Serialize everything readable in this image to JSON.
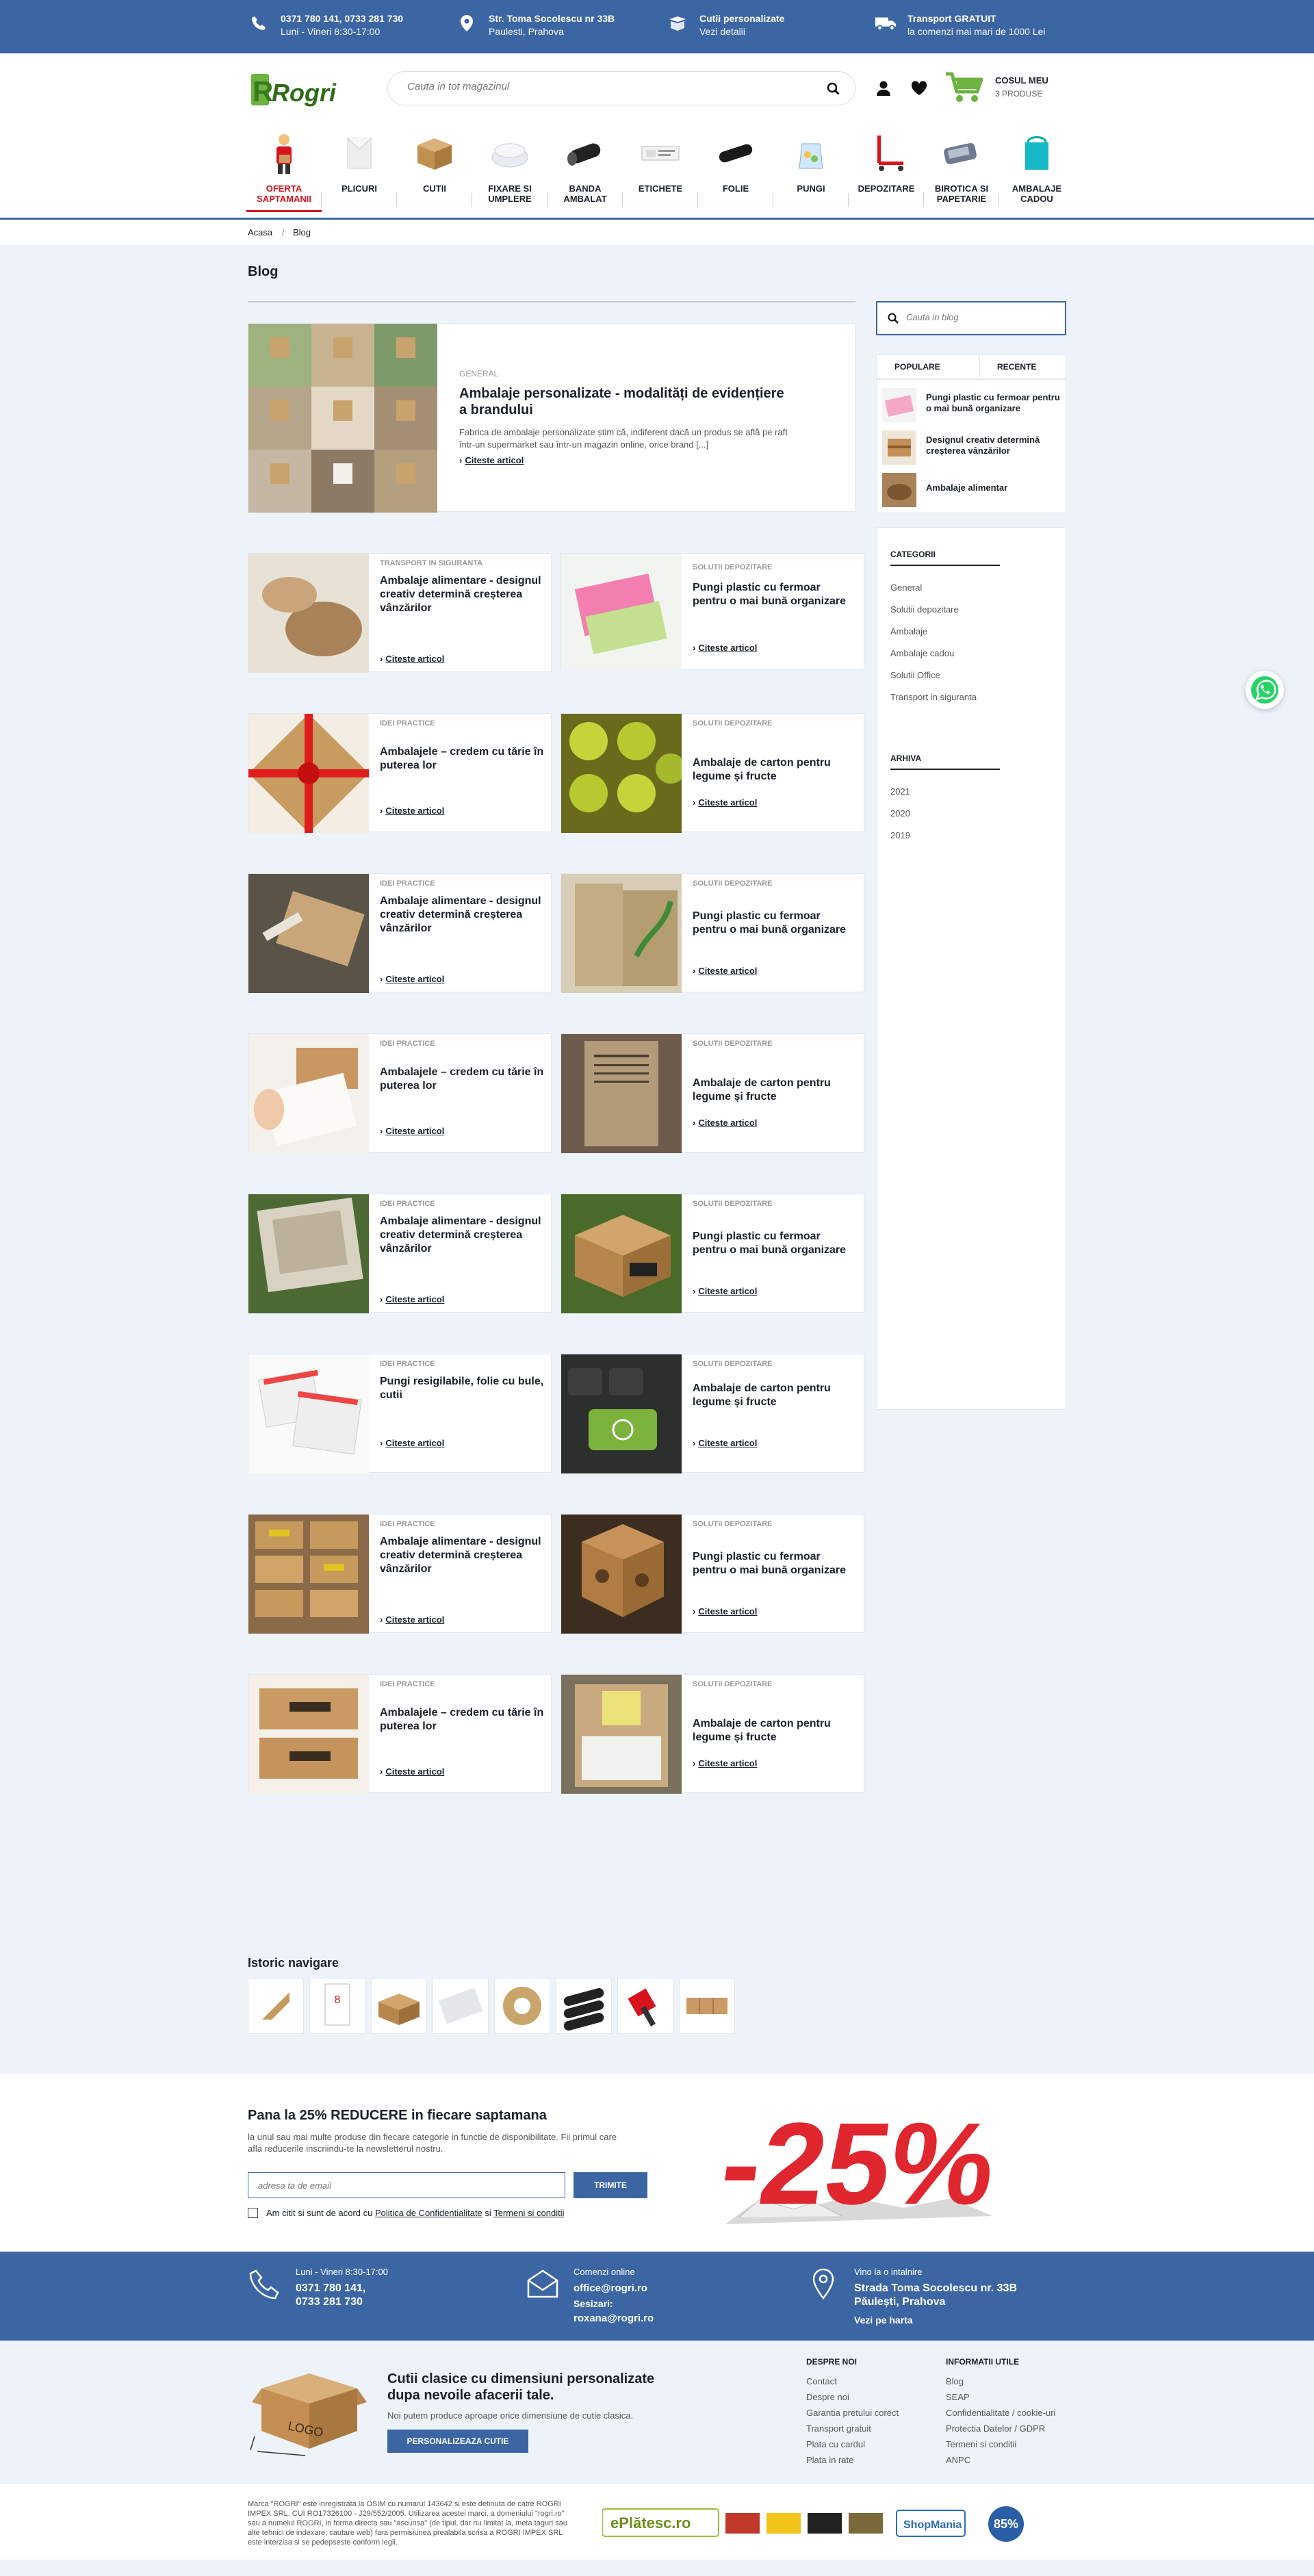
{
  "topbar": {
    "phone": {
      "line1": "0371 780 141, 0733 281 730",
      "line2": "Luni - Vineri 8:30-17:00"
    },
    "address": {
      "line1": "Str. Toma Socolescu nr 33B",
      "line2": "Paulesti, Prahova"
    },
    "custom": {
      "line1": "Cutii personalizate",
      "line2": "Vezi detalii"
    },
    "transport": {
      "line1": "Transport GRATUIT",
      "line2": "la comenzi mai mari de 1000 Lei"
    }
  },
  "logo": "Rogri",
  "search": {
    "placeholder": "Cauta in tot magazinul"
  },
  "cart": {
    "title": "COSUL MEU",
    "count": "3 PRODUSE"
  },
  "categories": [
    {
      "label": "OFERTA SAPTAMANII",
      "active": true
    },
    {
      "label": "PLICURI"
    },
    {
      "label": "CUTII"
    },
    {
      "label": "FIXARE SI UMPLERE"
    },
    {
      "label": "BANDA AMBALAT"
    },
    {
      "label": "ETICHETE"
    },
    {
      "label": "FOLIE"
    },
    {
      "label": "PUNGI"
    },
    {
      "label": "DEPOZITARE"
    },
    {
      "label": "BIROTICA SI PAPETARIE"
    },
    {
      "label": "AMBALAJE CADOU"
    }
  ],
  "breadcrumb": {
    "home": "Acasa",
    "sep": "/",
    "current": "Blog"
  },
  "page": {
    "title": "Blog"
  },
  "featured": {
    "tag": "GENERAL",
    "title": "Ambalaje personalizate - modalități de evidențiere a brandului",
    "excerpt": "Fabrica de ambalaje personalizate știm că, indiferent dacă un produs se află pe raft într-un supermarket sau într-un magazin online, orice brand [...]",
    "more": "Citeste articol"
  },
  "articles": [
    {
      "tag": "TRANSPORT IN SIGURANTA",
      "title": "Ambalaje alimentare - designul creativ determină creșterea vânzărilor",
      "more": "Citeste articol"
    },
    {
      "tag": "SOLUTII DEPOZITARE",
      "title": "Pungi plastic cu fermoar pentru o mai bună organizare",
      "more": "Citeste articol"
    },
    {
      "tag": "IDEI PRACTICE",
      "title": "Ambalajele – credem cu tărie în puterea lor",
      "more": "Citeste articol"
    },
    {
      "tag": "SOLUTII DEPOZITARE",
      "title": "Ambalaje de carton pentru legume și fructe",
      "more": "Citeste articol"
    },
    {
      "tag": "IDEI PRACTICE",
      "title": "Ambalaje alimentare - designul creativ determină creșterea vânzărilor",
      "more": "Citeste articol"
    },
    {
      "tag": "SOLUTII DEPOZITARE",
      "title": "Pungi plastic cu fermoar pentru o mai bună organizare",
      "more": "Citeste articol"
    },
    {
      "tag": "IDEI PRACTICE",
      "title": "Ambalajele – credem cu tărie în puterea lor",
      "more": "Citeste articol"
    },
    {
      "tag": "SOLUTII DEPOZITARE",
      "title": "Ambalaje de carton pentru legume și fructe",
      "more": "Citeste articol"
    },
    {
      "tag": "IDEI PRACTICE",
      "title": "Ambalaje alimentare - designul creativ determină creșterea vânzărilor",
      "more": "Citeste articol"
    },
    {
      "tag": "SOLUTII DEPOZITARE",
      "title": "Pungi plastic cu fermoar pentru o mai bună organizare",
      "more": "Citeste articol"
    },
    {
      "tag": "IDEI PRACTICE",
      "title": "Pungi resigilabile, folie cu bule, cutii",
      "more": "Citeste articol"
    },
    {
      "tag": "SOLUTII DEPOZITARE",
      "title": "Ambalaje de carton pentru legume și fructe",
      "more": "Citeste articol"
    },
    {
      "tag": "IDEI PRACTICE",
      "title": "Ambalaje alimentare - designul creativ determină creșterea vânzărilor",
      "more": "Citeste articol"
    },
    {
      "tag": "SOLUTII DEPOZITARE",
      "title": "Pungi plastic cu fermoar pentru o mai bună organizare",
      "more": "Citeste articol"
    },
    {
      "tag": "IDEI PRACTICE",
      "title": "Ambalajele – credem cu tărie în puterea lor",
      "more": "Citeste articol"
    },
    {
      "tag": "SOLUTII DEPOZITARE",
      "title": "Ambalaje de carton pentru legume și fructe",
      "more": "Citeste articol"
    }
  ],
  "sidebar": {
    "search_placeholder": "Cauta in blog",
    "tab_popular": "POPULARE",
    "tab_recent": "RECENTE",
    "popular": [
      "Pungi plastic cu fermoar pentru o mai bună organizare",
      "Designul creativ determină creșterea vânzărilor",
      "Ambalaje alimentar"
    ],
    "categories_title": "CATEGORII",
    "categories": [
      "General",
      "Solutii depozitare",
      "Ambalaje",
      "Ambalaje cadou",
      "Solutii Office",
      "Transport in siguranta"
    ],
    "archive_title": "ARHIVA",
    "archive": [
      "2021",
      "2020",
      "2019"
    ]
  },
  "history": {
    "title": "Istoric navigare"
  },
  "newsletter": {
    "title": "Pana la 25% REDUCERE in fiecare saptamana",
    "text": "la unul sau mai multe produse din fiecare categorie in functie de disponibilitate. Fii primul care afla reducerile inscriindu-te la newsletterul nostru.",
    "placeholder": "adresa ta de email",
    "button": "TRIMITE",
    "agree_prefix": "Am citit si sunt de acord cu",
    "privacy": "Politica de Confidentialitate",
    "and": "si",
    "terms": "Termeni si conditii",
    "promo": "-25%"
  },
  "contact": {
    "hours": "Luni - Vineri 8:30-17:00",
    "phones": [
      "0371 780 141,",
      "0733 281 730"
    ],
    "orders_label": "Comenzi online",
    "orders_email": "office@rogri.ro",
    "complaints_label": "Sesizari:",
    "complaints_email": "roxana@rogri.ro",
    "visit_label": "Vino la o intalnire",
    "address1": "Strada Toma Socolescu nr. 33B",
    "address2": "Păulești, Prahova",
    "map": "Vezi pe harta"
  },
  "footer": {
    "box_logo": "LOGO",
    "headline": "Cutii clasice cu dimensiuni personalizate dupa nevoile afacerii tale.",
    "sub": "Noi putem produce aproape orice dimensiune de cutie clasica.",
    "button": "PERSONALIZEAZA CUTIE",
    "about_title": "DESPRE NOI",
    "about": [
      "Contact",
      "Despre noi",
      "Garantia pretului corect",
      "Transport gratuit",
      "Plata cu cardul",
      "Plata in rate"
    ],
    "info_title": "INFORMATII UTILE",
    "info": [
      "Blog",
      "SEAP",
      "Confidentialitate / cookie-uri",
      "Protectia Datelor / GDPR",
      "Termeni si conditii",
      "ANPC"
    ]
  },
  "legal": {
    "text": "Marca \"ROGRI\" este inregistrata la OSIM cu numarul 143642 si este detinuta de catre ROGRI IMPEX SRL, CUI RO17326100 - J29/552/2005. Utilizarea acestei marci, a domeniului \"rogri.ro\" sau a numelui ROGRI, in forma directa sau \"ascunsa\" (de tipul, dar nu limitat la, meta taguri sau alte tehnici de indexare, cautare web) fara permisiunea prealabila scrisa a ROGRI IMPEX SRL este interzisa si se pedepseste conform legii.",
    "platesc": "ePlătesc.ro",
    "shopmania": "ShopMania",
    "score": "85%"
  },
  "colors": {
    "brand": "#3c66a3",
    "accent": "#d7141d",
    "logo_green": "#6cb33f"
  }
}
